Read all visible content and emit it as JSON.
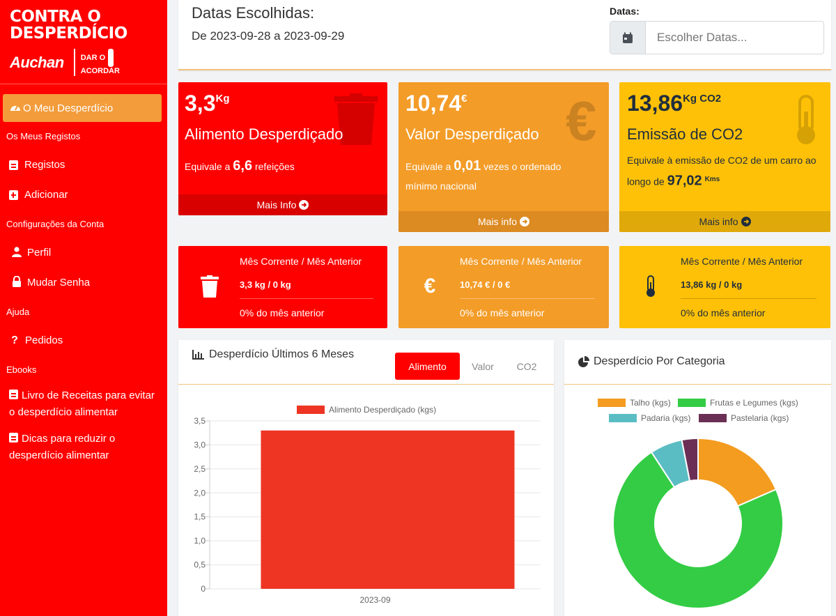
{
  "sidebar": {
    "logo_line1": "CONTRA O",
    "logo_line2": "DESPERDÍCIO",
    "logo_brand": "Auchan",
    "logo_partner_line1": "DAR O",
    "logo_partner_line2": "ACORDAR",
    "active_item": "O Meu Desperdício",
    "sections": [
      {
        "header": "Os Meus Registos",
        "items": [
          "Registos",
          "Adicionar"
        ]
      },
      {
        "header": "Configurações da Conta",
        "items": [
          "Perfil",
          "Mudar Senha"
        ]
      },
      {
        "header": "Ajuda",
        "items": [
          "Pedidos"
        ]
      },
      {
        "header": "Ebooks",
        "items": [
          "Livro de Receitas para evitar o desperdício alimentar",
          "Dicas para reduzir o desperdício alimentar"
        ]
      }
    ]
  },
  "header": {
    "title": "Datas Escolhidas:",
    "range": "De 2023-09-28 a 2023-09-29",
    "dates_label": "Datas:",
    "dates_placeholder": "Escolher Datas..."
  },
  "stats": [
    {
      "value": "3,3",
      "unit": "Kg",
      "label": "Alimento Desperdiçado",
      "desc_prefix": "Equivale a ",
      "desc_value": "6,6",
      "desc_suffix": " refeições",
      "footer": "Mais Info",
      "color": "#ff0000",
      "icon": "trash-icon"
    },
    {
      "value": "10,74",
      "unit": "€",
      "label": "Valor Desperdiçado",
      "desc_prefix": "Equivale a ",
      "desc_value": "0,01",
      "desc_suffix": " vezes o ordenado mínimo nacional",
      "footer": "Mais info",
      "color": "#f39c28",
      "icon": "euro-icon"
    },
    {
      "value": "13,86",
      "unit": "Kg CO2",
      "label": "Emissão de CO2",
      "desc_prefix": "Equivale à emissão de CO2 de um carro ao longo de ",
      "desc_value": "97,02",
      "desc_suffix": "Kms",
      "footer": "Mais info",
      "color": "#ffc107",
      "icon": "thermometer-icon"
    }
  ],
  "compare": [
    {
      "title": "Mês Corrente / Mês Anterior",
      "value": "3,3 kg / 0 kg",
      "pct": "0% do mês anterior",
      "icon": "trash-icon"
    },
    {
      "title": "Mês Corrente / Mês Anterior",
      "value": "10,74 € / 0 €",
      "pct": "0% do mês anterior",
      "icon": "euro-icon"
    },
    {
      "title": "Mês Corrente / Mês Anterior",
      "value": "13,86 kg / 0 kg",
      "pct": "0% do mês anterior",
      "icon": "thermometer-icon"
    }
  ],
  "bar_card": {
    "title": "Desperdício Últimos 6 Meses",
    "tabs": [
      "Alimento",
      "Valor",
      "CO2"
    ],
    "active_tab": "Alimento"
  },
  "pie_card": {
    "title": "Desperdício Por Categoria"
  },
  "chart_data": [
    {
      "type": "bar",
      "categories": [
        "2023-09"
      ],
      "series": [
        {
          "name": "Alimento Desperdiçado (kgs)",
          "values": [
            3.3
          ],
          "color": "#ee3524"
        }
      ],
      "yticks": [
        "0",
        "0,5",
        "1,0",
        "1,5",
        "2,0",
        "2,5",
        "3,0",
        "3,5"
      ],
      "ylim": [
        0,
        3.5
      ],
      "legend": "top"
    },
    {
      "type": "pie",
      "categories": [
        "Talho (kgs)",
        "Frutas e Legumes (kgs)",
        "Padaria (kgs)",
        "Pastelaria (kgs)"
      ],
      "values": [
        0.6,
        2.35,
        0.2,
        0.1
      ],
      "colors": [
        "#f39c20",
        "#33cc44",
        "#5bbdc4",
        "#6b2f55"
      ],
      "legend": "top"
    }
  ]
}
